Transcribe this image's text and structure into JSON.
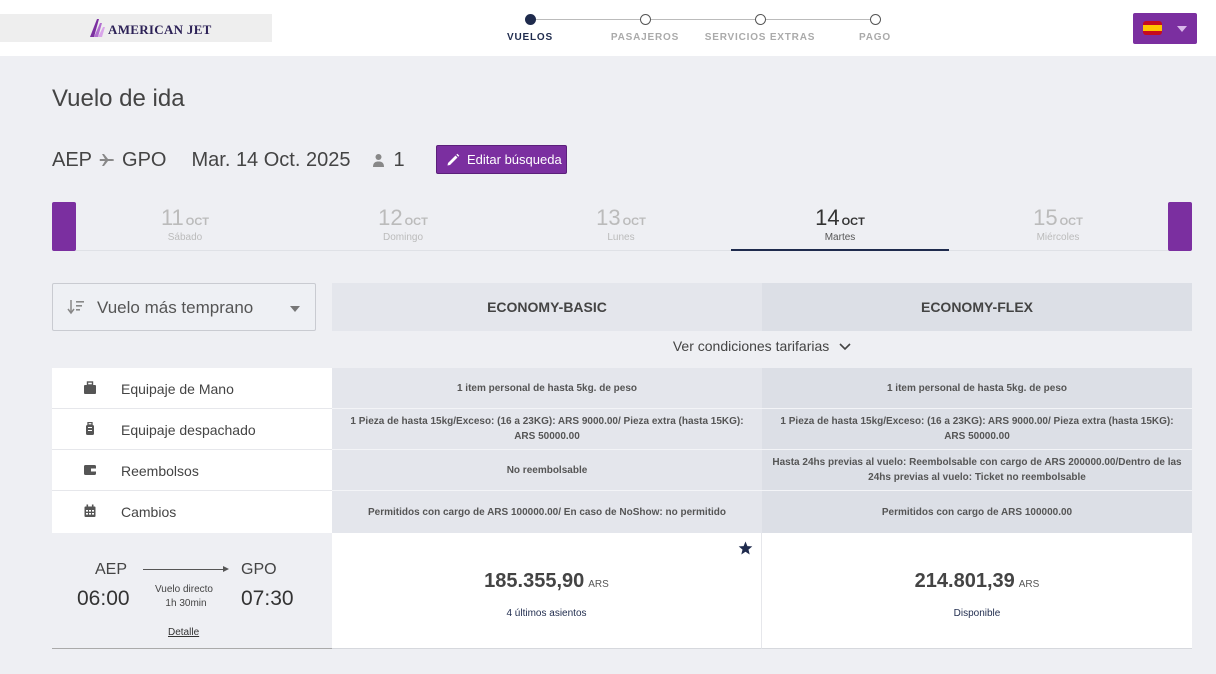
{
  "brand": {
    "logo_text": "AMERICAN JET"
  },
  "steps": [
    {
      "label": "VUELOS",
      "active": true
    },
    {
      "label": "PASAJEROS",
      "active": false
    },
    {
      "label": "SERVICIOS EXTRAS",
      "active": false
    },
    {
      "label": "PAGO",
      "active": false
    }
  ],
  "language": {
    "flag_icon": "spain-flag-icon"
  },
  "page": {
    "title": "Vuelo de ida"
  },
  "search": {
    "origin": "AEP",
    "destination": "GPO",
    "date": "Mar. 14 Oct. 2025",
    "passengers": "1",
    "edit_label": "Editar búsqueda"
  },
  "dates": [
    {
      "day": "11",
      "month": "OCT",
      "weekday": "Sábado",
      "active": false
    },
    {
      "day": "12",
      "month": "OCT",
      "weekday": "Domingo",
      "active": false
    },
    {
      "day": "13",
      "month": "OCT",
      "weekday": "Lunes",
      "active": false
    },
    {
      "day": "14",
      "month": "OCT",
      "weekday": "Martes",
      "active": true
    },
    {
      "day": "15",
      "month": "OCT",
      "weekday": "Miércoles",
      "active": false
    }
  ],
  "sort": {
    "selected": "Vuelo más temprano"
  },
  "fares": {
    "basic": {
      "name": "ECONOMY-BASIC"
    },
    "flex": {
      "name": "ECONOMY-FLEX"
    },
    "conditions_link": "Ver condiciones tarifarias"
  },
  "features": [
    {
      "label": "Equipaje de Mano",
      "icon": "briefcase-icon",
      "basic": "1 item personal de hasta 5kg. de peso",
      "flex": "1 item personal de hasta 5kg. de peso"
    },
    {
      "label": "Equipaje despachado",
      "icon": "luggage-icon",
      "basic": "1 Pieza de hasta 15kg/Exceso: (16 a 23KG): ARS 9000.00/ Pieza extra (hasta 15KG): ARS 50000.00",
      "flex": "1 Pieza de hasta 15kg/Exceso: (16 a 23KG): ARS 9000.00/ Pieza extra (hasta 15KG): ARS 50000.00"
    },
    {
      "label": "Reembolsos",
      "icon": "wallet-icon",
      "basic": "No reembolsable",
      "flex": "Hasta 24hs previas al vuelo: Reembolsable con cargo de ARS 200000.00/Dentro de las 24hs previas al vuelo: Ticket no reembolsable"
    },
    {
      "label": "Cambios",
      "icon": "calendar-icon",
      "basic": "Permitidos con cargo de ARS 100000.00/ En caso de NoShow: no permitido",
      "flex": "Permitidos con cargo de ARS 100000.00"
    }
  ],
  "flight": {
    "origin": "AEP",
    "destination": "GPO",
    "depart": "06:00",
    "arrive": "07:30",
    "type": "Vuelo directo",
    "duration": "1h 30min",
    "detail_link": "Detalle"
  },
  "prices": {
    "basic": {
      "amount": "185.355,90",
      "currency": "ARS",
      "status": "4 últimos asientos"
    },
    "flex": {
      "amount": "214.801,39",
      "currency": "ARS",
      "status": "Disponible"
    }
  }
}
